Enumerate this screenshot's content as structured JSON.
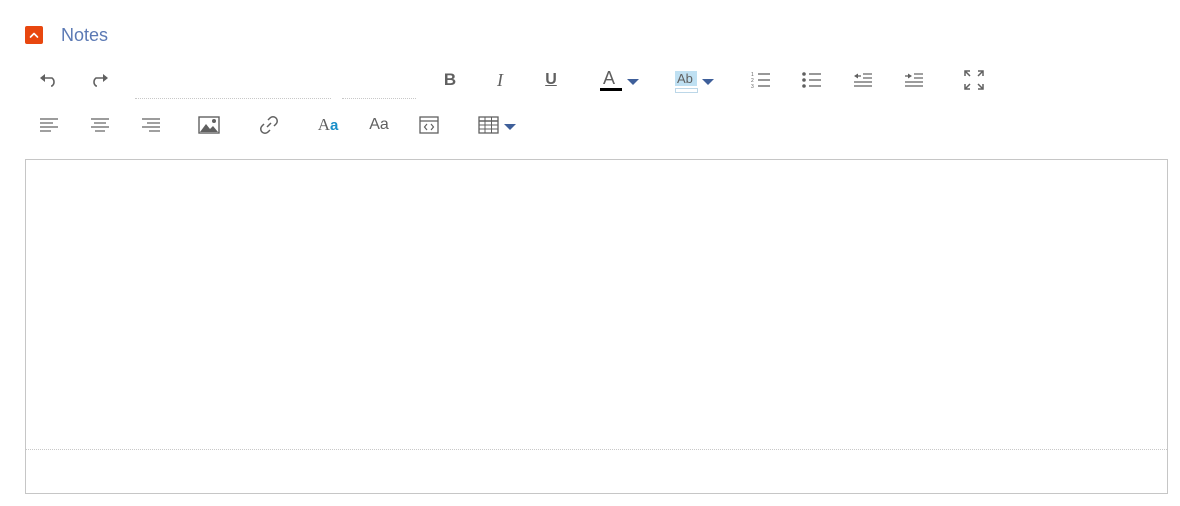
{
  "section": {
    "title": "Notes",
    "collapse_icon": "chevron-up-icon",
    "accent_color": "#e8470f",
    "title_color": "#5b79b4"
  },
  "toolbar": {
    "row1": [
      "undo-icon",
      "redo-icon",
      "font-family-select",
      "font-size-select",
      "bold-icon",
      "italic-icon",
      "underline-icon",
      "text-color-icon",
      "highlight-color-icon",
      "numbered-list-icon",
      "bulleted-list-icon",
      "outdent-icon",
      "indent-icon",
      "fullscreen-icon"
    ],
    "row2": [
      "align-left-icon",
      "align-center-icon",
      "align-right-icon",
      "image-icon",
      "link-icon",
      "text-style-icon",
      "clear-format-icon",
      "source-code-icon",
      "table-icon"
    ],
    "bold_glyph": "B",
    "italic_glyph": "I",
    "underline_glyph": "U",
    "text_color_glyph": "A",
    "highlight_glyph": "Ab",
    "text_style_glyph_a": "A",
    "text_style_glyph_b": "a",
    "clear_format_glyph": "Aa",
    "dropdown_color": "#3e5f9a",
    "text_color_swatch": "#000000",
    "highlight_swatch": "#bfe0f2"
  },
  "editor": {
    "content": "",
    "border_color": "#c6c6c6"
  }
}
